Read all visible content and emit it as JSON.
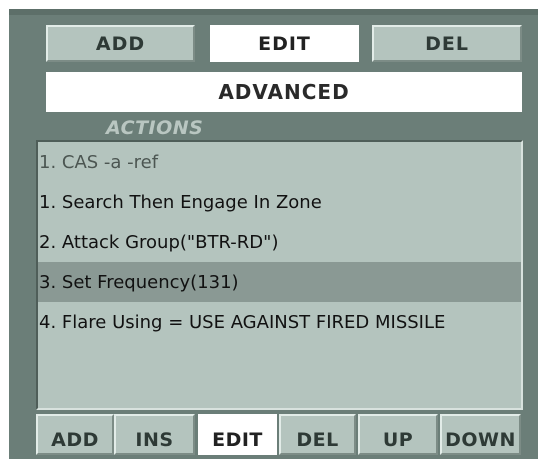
{
  "top_buttons": {
    "add": "ADD",
    "edit": "EDIT",
    "del": "DEL",
    "active": "edit"
  },
  "advanced_label": "ADVANCED",
  "actions_title": "ACTIONS",
  "actions_list": {
    "header": "1. CAS -a -ref",
    "items": [
      "1. Search Then Engage In Zone",
      "2. Attack Group(\"BTR-RD\")",
      "3. Set Frequency(131)",
      "4. Flare Using = USE AGAINST FIRED MISSILE"
    ],
    "selected_index": 2
  },
  "bottom_buttons": {
    "add": "ADD",
    "ins": "INS",
    "edit": "EDIT",
    "del": "DEL",
    "up": "UP",
    "down": "DOWN",
    "active": "edit"
  },
  "colors": {
    "panel": "#6b7e78",
    "button": "#b4c4be",
    "list_bg": "#b4c4be",
    "selected_row": "#8a9994",
    "active_button": "#ffffff"
  }
}
